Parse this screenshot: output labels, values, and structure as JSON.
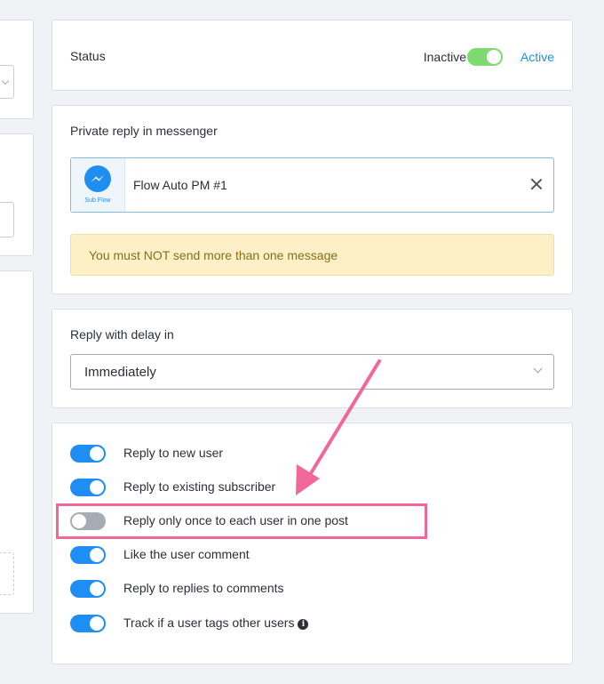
{
  "status": {
    "label": "Status",
    "inactive_label": "Inactive",
    "active_label": "Active",
    "is_active": true
  },
  "private_reply": {
    "title": "Private reply in messenger",
    "flow": {
      "icon": "messenger-icon",
      "icon_caption": "Sub Flow",
      "name": "Flow Auto PM #1"
    },
    "warning": "You must NOT send more than one message"
  },
  "delay": {
    "title": "Reply with delay in",
    "selected": "Immediately"
  },
  "toggles": [
    {
      "label": "Reply to new user",
      "on": true
    },
    {
      "label": "Reply to existing subscriber",
      "on": true
    },
    {
      "label": "Reply only once to each user in one post",
      "on": false
    },
    {
      "label": "Like the user comment",
      "on": true
    },
    {
      "label": "Reply to replies to comments",
      "on": true
    },
    {
      "label": "Track if a user tags other users",
      "on": true,
      "info": "i"
    }
  ],
  "colors": {
    "accent": "#1e8ef5",
    "status_on": "#7ed96e",
    "highlight": "#f2679a",
    "warning_bg": "#fdf0c6"
  }
}
